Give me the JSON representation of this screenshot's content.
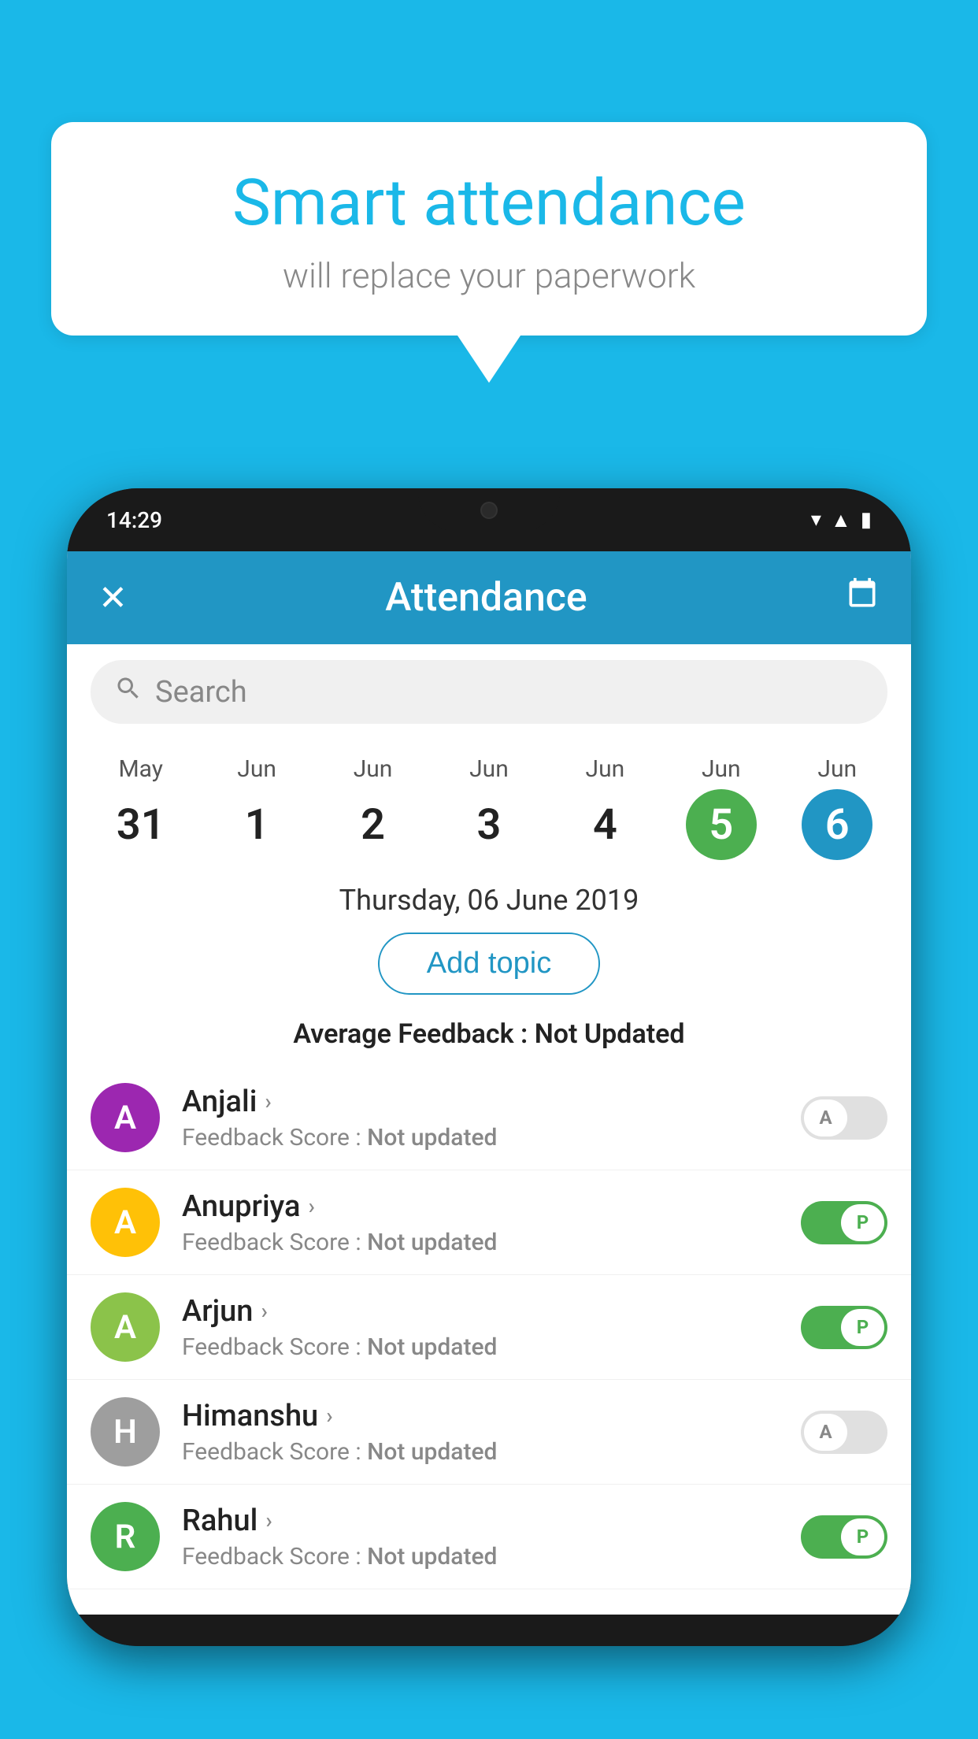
{
  "background_color": "#1ab8e8",
  "speech_bubble": {
    "title": "Smart attendance",
    "subtitle": "will replace your paperwork"
  },
  "phone": {
    "status_bar": {
      "time": "14:29"
    },
    "app_bar": {
      "title": "Attendance",
      "close_label": "✕",
      "calendar_label": "📅"
    },
    "search": {
      "placeholder": "Search"
    },
    "calendar": {
      "days": [
        {
          "month": "May",
          "date": "31",
          "highlight": ""
        },
        {
          "month": "Jun",
          "date": "1",
          "highlight": ""
        },
        {
          "month": "Jun",
          "date": "2",
          "highlight": ""
        },
        {
          "month": "Jun",
          "date": "3",
          "highlight": ""
        },
        {
          "month": "Jun",
          "date": "4",
          "highlight": ""
        },
        {
          "month": "Jun",
          "date": "5",
          "highlight": "green"
        },
        {
          "month": "Jun",
          "date": "6",
          "highlight": "blue"
        }
      ]
    },
    "selected_date": "Thursday, 06 June 2019",
    "add_topic_label": "Add topic",
    "avg_feedback_label": "Average Feedback :",
    "avg_feedback_value": "Not Updated",
    "students": [
      {
        "name": "Anjali",
        "avatar_letter": "A",
        "avatar_color": "#9c27b0",
        "feedback_label": "Feedback Score :",
        "feedback_value": "Not updated",
        "toggle": "off"
      },
      {
        "name": "Anupriya",
        "avatar_letter": "A",
        "avatar_color": "#ffc107",
        "feedback_label": "Feedback Score :",
        "feedback_value": "Not updated",
        "toggle": "on"
      },
      {
        "name": "Arjun",
        "avatar_letter": "A",
        "avatar_color": "#8bc34a",
        "feedback_label": "Feedback Score :",
        "feedback_value": "Not updated",
        "toggle": "on"
      },
      {
        "name": "Himanshu",
        "avatar_letter": "H",
        "avatar_color": "#9e9e9e",
        "feedback_label": "Feedback Score :",
        "feedback_value": "Not updated",
        "toggle": "off"
      },
      {
        "name": "Rahul",
        "avatar_letter": "R",
        "avatar_color": "#4caf50",
        "feedback_label": "Feedback Score :",
        "feedback_value": "Not updated",
        "toggle": "on"
      }
    ]
  }
}
